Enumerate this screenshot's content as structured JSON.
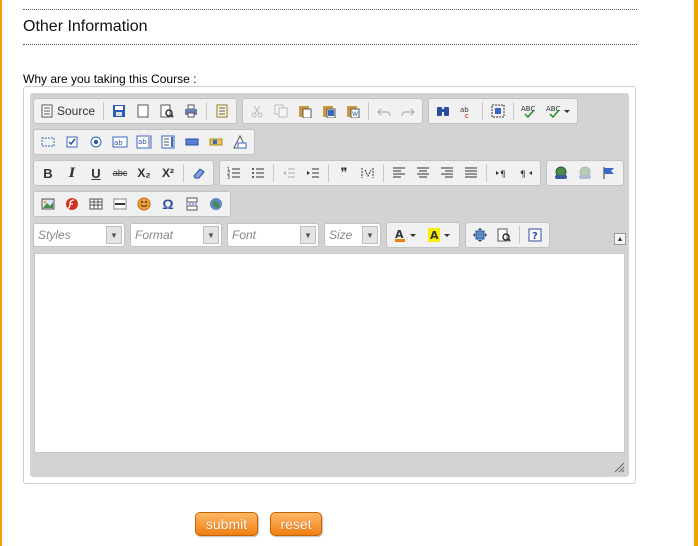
{
  "section": {
    "title": "Other Information"
  },
  "question": {
    "label": "Why are you taking this Course   :"
  },
  "editor": {
    "source_label": "Source",
    "combos": {
      "styles": "Styles",
      "format": "Format",
      "font": "Font",
      "size": "Size"
    },
    "glyphs": {
      "bold": "B",
      "italic": "I",
      "underline": "U",
      "strike": "abc",
      "subscript": "X₂",
      "superscript": "X²",
      "spell_abc": "ABC",
      "quote": "❞",
      "omega": "Ω",
      "help": "?"
    },
    "value": ""
  },
  "buttons": {
    "submit": "submit",
    "reset": "reset"
  },
  "colors": {
    "accent": "#f0a000",
    "button_top": "#ffb866",
    "button_bottom": "#f07f10",
    "toolbar_bg": "#d3d3d3"
  }
}
